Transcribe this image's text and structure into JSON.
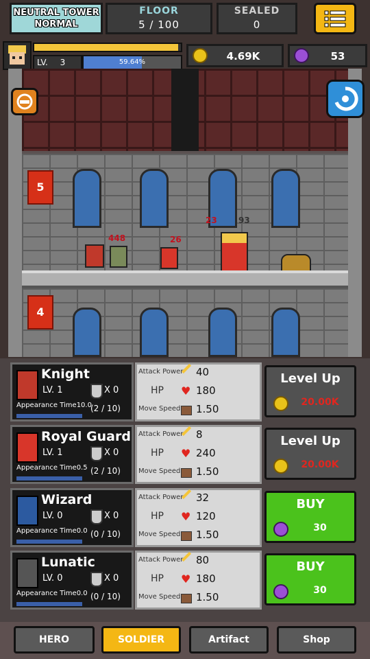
{
  "header": {
    "tower_name": "NEUTRAL TOWER",
    "tower_mode": "NORMAL",
    "floor_label": "FLOOR",
    "floor_value": "5 / 100",
    "sealed_label": "SEALED",
    "sealed_value": "0"
  },
  "player": {
    "level_label": "LV.",
    "level_value": "3",
    "exp_text": "59.64%",
    "exp_fraction": 0.5964,
    "hp_fraction": 0.98,
    "gold": "4.69K",
    "gems": "53"
  },
  "tower": {
    "floors": [
      {
        "number": "5"
      },
      {
        "number": "4"
      }
    ],
    "damage_texts": [
      "448",
      "26",
      "23",
      "93"
    ]
  },
  "soldiers": [
    {
      "name": "Knight",
      "level": "LV. 1",
      "medals": "X 0",
      "appearance": "Appearance Time10.0",
      "count": "(2 / 10)",
      "attack_label": "Attack Power",
      "attack": "40",
      "hp_label": "HP",
      "hp": "180",
      "speed_label": "Move Speed",
      "speed": "1.50",
      "action": "Level Up",
      "cost": "20.00K",
      "cost_type": "gold"
    },
    {
      "name": "Royal Guard",
      "level": "LV. 1",
      "medals": "X 0",
      "appearance": "Appearance Time0.5",
      "count": "(2 / 10)",
      "attack_label": "Attack Power",
      "attack": "8",
      "hp_label": "HP",
      "hp": "240",
      "speed_label": "Move Speed",
      "speed": "1.50",
      "action": "Level Up",
      "cost": "20.00K",
      "cost_type": "gold"
    },
    {
      "name": "Wizard",
      "level": "LV. 0",
      "medals": "X 0",
      "appearance": "Appearance Time0.0",
      "count": "(0 / 10)",
      "attack_label": "Attack Power",
      "attack": "32",
      "hp_label": "HP",
      "hp": "120",
      "speed_label": "Move Speed",
      "speed": "1.50",
      "action": "BUY",
      "cost": "30",
      "cost_type": "gem"
    },
    {
      "name": "Lunatic",
      "level": "LV. 0",
      "medals": "X 0",
      "appearance": "Appearance Time0.0",
      "count": "(0 / 10)",
      "attack_label": "Attack Power",
      "attack": "80",
      "hp_label": "HP",
      "hp": "180",
      "speed_label": "Move Speed",
      "speed": "1.50",
      "action": "BUY",
      "cost": "30",
      "cost_type": "gem"
    }
  ],
  "tabs": [
    {
      "label": "HERO"
    },
    {
      "label": "SOLDIER"
    },
    {
      "label": "Artifact"
    },
    {
      "label": "Shop"
    }
  ],
  "colors": {
    "accent_gold": "#f4b714",
    "buy_green": "#4bc21c",
    "cost_red": "#e0261f",
    "banner_red": "#d63018"
  }
}
